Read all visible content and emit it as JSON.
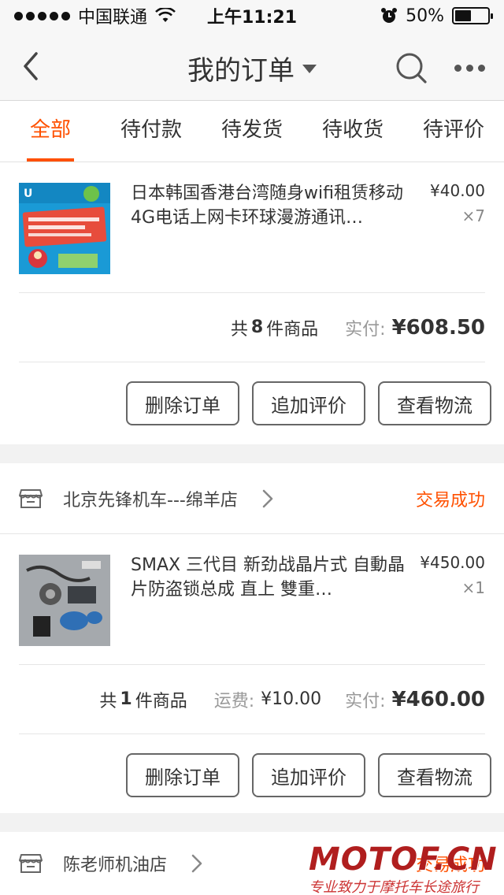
{
  "status_bar": {
    "carrier": "中国联通",
    "time": "上午11:21",
    "battery": "50%",
    "battery_level": 0.5
  },
  "nav": {
    "title": "我的订单"
  },
  "tabs": [
    {
      "label": "全部",
      "active": true
    },
    {
      "label": "待付款",
      "active": false
    },
    {
      "label": "待发货",
      "active": false
    },
    {
      "label": "待收货",
      "active": false
    },
    {
      "label": "待评价",
      "active": false
    }
  ],
  "orders": [
    {
      "item": {
        "title": "日本韩国香港台湾随身wifi租赁移动4G电话上网卡环球漫游通讯…",
        "price": "¥40.00",
        "qty": "×7"
      },
      "summary": {
        "count_prefix": "共",
        "count": "8",
        "count_suffix": "件商品",
        "paid_label": "实付:",
        "paid": "¥608.50"
      },
      "buttons": [
        "删除订单",
        "追加评价",
        "查看物流"
      ]
    },
    {
      "shop_name": "北京先锋机车---绵羊店",
      "status": "交易成功",
      "item": {
        "title": "SMAX 三代目 新劲战晶片式 自動晶片防盗锁总成 直上 雙重…",
        "price": "¥450.00",
        "qty": "×1"
      },
      "summary": {
        "count_prefix": "共",
        "count": "1",
        "count_suffix": "件商品",
        "shipping_label": "运费:",
        "shipping": "¥10.00",
        "paid_label": "实付:",
        "paid": "¥460.00"
      },
      "buttons": [
        "删除订单",
        "追加评价",
        "查看物流"
      ]
    },
    {
      "shop_name": "陈老师机油店",
      "status": "交易成功"
    }
  ],
  "watermark": {
    "logo": "MOTOF.CN",
    "tagline": "专业致力于摩托车长途旅行"
  },
  "colors": {
    "accent": "#ff5000",
    "watermark": "#b01e1e"
  },
  "icons": [
    "back-icon",
    "search-icon",
    "more-icon",
    "shop-icon",
    "chevron-right-icon",
    "wifi-icon",
    "alarm-icon"
  ]
}
